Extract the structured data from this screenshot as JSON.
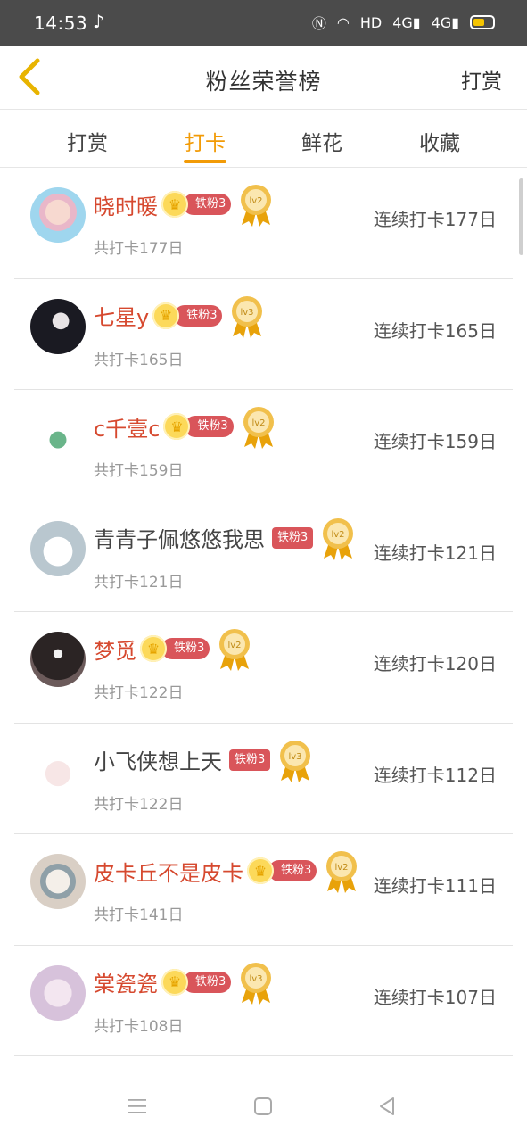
{
  "status_bar": {
    "time": "14:53",
    "network": "HD",
    "signal1": "4G",
    "signal2": "4G"
  },
  "header": {
    "title": "粉丝荣誉榜",
    "action": "打赏"
  },
  "tabs": [
    {
      "label": "打赏"
    },
    {
      "label": "打卡",
      "active": true
    },
    {
      "label": "鲜花"
    },
    {
      "label": "收藏"
    }
  ],
  "list": [
    {
      "name": "晓时暖",
      "fan_badge": "铁粉3",
      "level": "lv2",
      "total": "共打卡177日",
      "streak": "连续打卡177日"
    },
    {
      "name": "七星y",
      "fan_badge": "铁粉3",
      "level": "lv3",
      "total": "共打卡165日",
      "streak": "连续打卡165日"
    },
    {
      "name": "c千壹c",
      "fan_badge": "铁粉3",
      "level": "lv2",
      "total": "共打卡159日",
      "streak": "连续打卡159日"
    },
    {
      "name": "青青子佩悠悠我思",
      "fan_badge": "铁粉3",
      "level": "lv2",
      "total": "共打卡121日",
      "streak": "连续打卡121日"
    },
    {
      "name": "梦觅",
      "fan_badge": "铁粉3",
      "level": "lv2",
      "total": "共打卡122日",
      "streak": "连续打卡120日"
    },
    {
      "name": "小飞侠想上天",
      "fan_badge": "铁粉3",
      "level": "lv3",
      "total": "共打卡122日",
      "streak": "连续打卡112日"
    },
    {
      "name": "皮卡丘不是皮卡",
      "fan_badge": "铁粉3",
      "level": "lv2",
      "total": "共打卡141日",
      "streak": "连续打卡111日"
    },
    {
      "name": "棠瓷瓷",
      "fan_badge": "铁粉3",
      "level": "lv3",
      "total": "共打卡108日",
      "streak": "连续打卡107日"
    }
  ],
  "colors": {
    "accent": "#f29b07",
    "name_highlight": "#d6492f",
    "badge": "#d9555a"
  }
}
